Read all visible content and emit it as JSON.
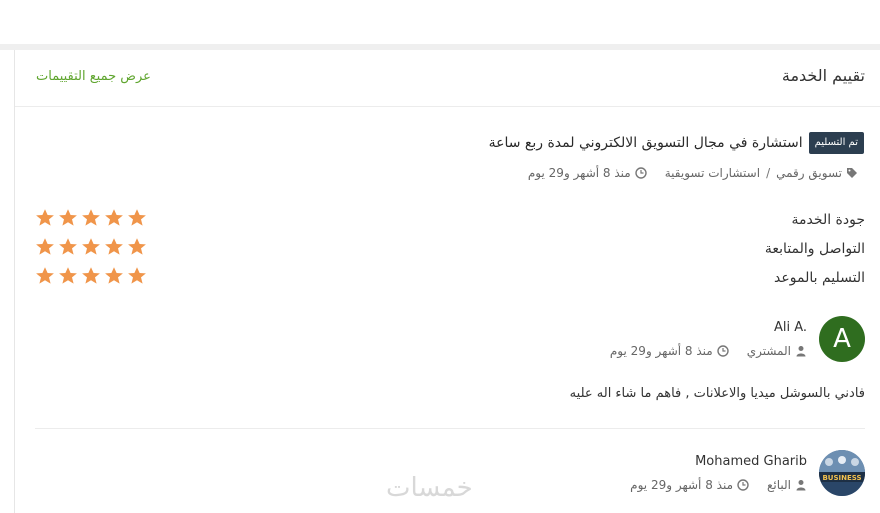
{
  "section": {
    "title": "تقييم الخدمة",
    "all_link": "عرض جميع التقييمات"
  },
  "service": {
    "badge": "تم التسليم",
    "title": "استشارة في مجال التسويق الالكتروني لمدة ربع ساعة",
    "category": "تسويق رقمي",
    "subcategory": "استشارات تسويقية",
    "time": "منذ 8 أشهر و29 يوم"
  },
  "ratings": [
    {
      "label": "جودة الخدمة",
      "stars": 5
    },
    {
      "label": "التواصل والمتابعة",
      "stars": 5
    },
    {
      "label": "التسليم بالموعد",
      "stars": 5
    }
  ],
  "review": {
    "avatar_letter": "A",
    "name": "Ali A.",
    "role": "المشتري",
    "time": "منذ 8 أشهر و29 يوم",
    "text": "فادني بالسوشل ميديا والاعلانات , فاهم ما شاء اله عليه"
  },
  "reply": {
    "avatar_text": "BUSINESS",
    "name": "Mohamed Gharib",
    "role": "البائع",
    "time": "منذ 8 أشهر و29 يوم"
  },
  "watermark": "خمسات",
  "colors": {
    "accent_green": "#5fa52e",
    "star": "#f0954a",
    "badge": "#2c3e50",
    "avatar": "#2f6d1f"
  }
}
